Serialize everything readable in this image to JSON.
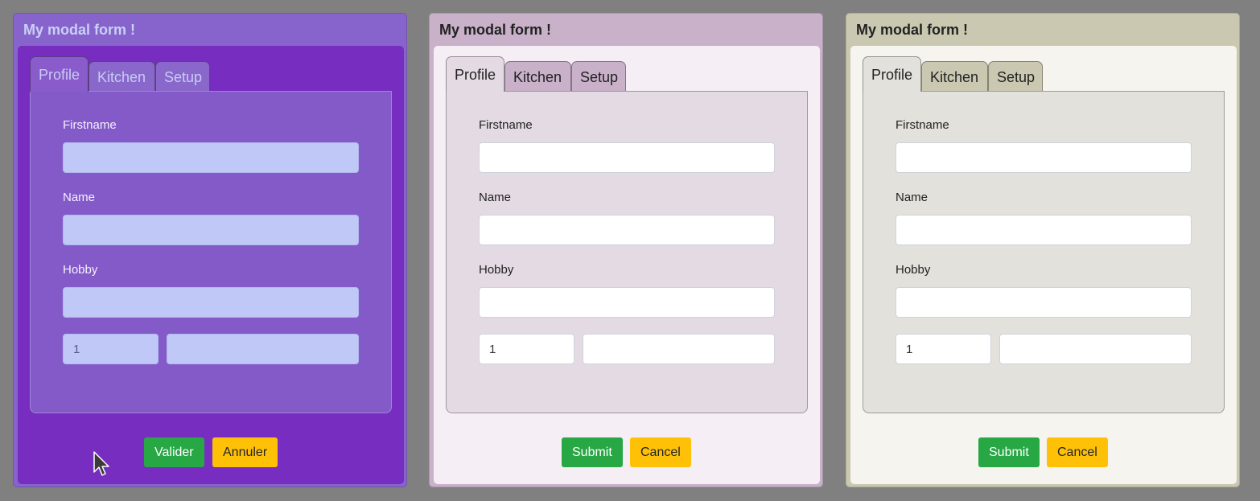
{
  "modals": [
    {
      "theme": "purple",
      "title": "My modal form !",
      "tabs": [
        "Profile",
        "Kitchen",
        "Setup"
      ],
      "active_tab": "Profile",
      "fields": {
        "firstname_label": "Firstname",
        "name_label": "Name",
        "hobby_label": "Hobby"
      },
      "number_value": "1",
      "submit_label": "Valider",
      "cancel_label": "Annuler"
    },
    {
      "theme": "pink",
      "title": "My modal form !",
      "tabs": [
        "Profile",
        "Kitchen",
        "Setup"
      ],
      "active_tab": "Profile",
      "fields": {
        "firstname_label": "Firstname",
        "name_label": "Name",
        "hobby_label": "Hobby"
      },
      "number_value": "1",
      "submit_label": "Submit",
      "cancel_label": "Cancel"
    },
    {
      "theme": "khaki",
      "title": "My modal form !",
      "tabs": [
        "Profile",
        "Kitchen",
        "Setup"
      ],
      "active_tab": "Profile",
      "fields": {
        "firstname_label": "Firstname",
        "name_label": "Name",
        "hobby_label": "Hobby"
      },
      "number_value": "1",
      "submit_label": "Submit",
      "cancel_label": "Cancel"
    }
  ],
  "colors": {
    "background": "#808080",
    "purple_frame": "#8764cb",
    "purple_body": "#772dc0",
    "pink_frame": "#c9b1c9",
    "khaki_frame": "#cbc8b2",
    "submit_button": "#28a745",
    "cancel_button": "#ffc107"
  },
  "cursor": {
    "icon": "mouse-pointer-icon"
  }
}
